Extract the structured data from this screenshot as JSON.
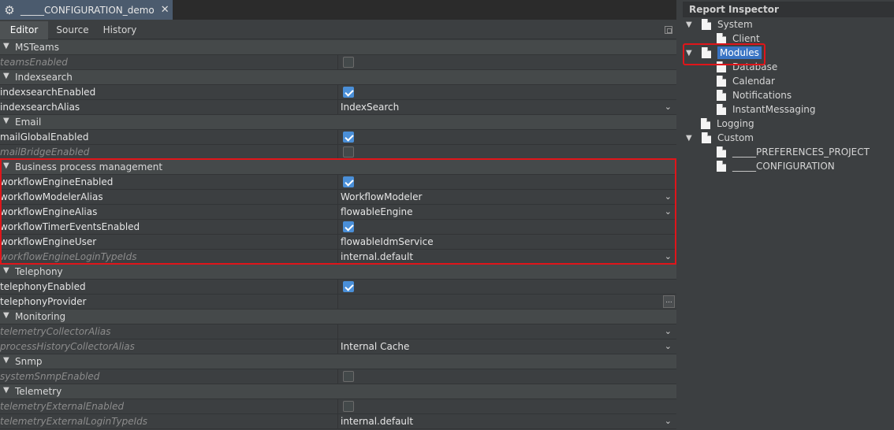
{
  "file_tab": {
    "title": "_____CONFIGURATION_demo",
    "close": "✕"
  },
  "sub_tabs": {
    "editor": "Editor",
    "source": "Source",
    "history": "History"
  },
  "sections": {
    "msteams": "MSTeams",
    "indexsearch": "Indexsearch",
    "email": "Email",
    "bpm": "Business process management",
    "telephony": "Telephony",
    "monitoring": "Monitoring",
    "snmp": "Snmp",
    "telemetry": "Telemetry"
  },
  "props": {
    "teamsEnabled": {
      "key": "teamsEnabled",
      "checked": false
    },
    "indexsearchEnabled": {
      "key": "indexsearchEnabled",
      "checked": true
    },
    "indexsearchAlias": {
      "key": "indexsearchAlias",
      "value": "IndexSearch"
    },
    "mailGlobalEnabled": {
      "key": "mailGlobalEnabled",
      "checked": true
    },
    "mailBridgeEnabled": {
      "key": "mailBridgeEnabled",
      "checked": false
    },
    "workflowEngineEnabled": {
      "key": "workflowEngineEnabled",
      "checked": true
    },
    "workflowModelerAlias": {
      "key": "workflowModelerAlias",
      "value": "WorkflowModeler"
    },
    "workflowEngineAlias": {
      "key": "workflowEngineAlias",
      "value": "flowableEngine"
    },
    "workflowTimerEventsEnabled": {
      "key": "workflowTimerEventsEnabled",
      "checked": true
    },
    "workflowEngineUser": {
      "key": "workflowEngineUser",
      "value": "flowableIdmService"
    },
    "workflowEngineLoginTypeIds": {
      "key": "workflowEngineLoginTypeIds",
      "value": "internal.default"
    },
    "telephonyEnabled": {
      "key": "telephonyEnabled",
      "checked": true
    },
    "telephonyProvider": {
      "key": "telephonyProvider",
      "button": "..."
    },
    "telemetryCollectorAlias": {
      "key": "telemetryCollectorAlias",
      "value": ""
    },
    "processHistoryCollectorAlias": {
      "key": "processHistoryCollectorAlias",
      "value": "Internal Cache"
    },
    "systemSnmpEnabled": {
      "key": "systemSnmpEnabled",
      "checked": false
    },
    "telemetryExternalEnabled": {
      "key": "telemetryExternalEnabled",
      "checked": false
    },
    "telemetryExternalLoginTypeIds": {
      "key": "telemetryExternalLoginTypeIds",
      "value": "internal.default"
    }
  },
  "inspector": {
    "title": "Report Inspector",
    "tree": {
      "system": "System",
      "client": "Client",
      "modules": "Modules",
      "database": "Database",
      "calendar": "Calendar",
      "notifications": "Notifications",
      "instant_messaging": "InstantMessaging",
      "logging": "Logging",
      "custom": "Custom",
      "preferences_project": "_____PREFERENCES_PROJECT",
      "configuration": "_____CONFIGURATION"
    }
  },
  "colors": {
    "highlight_box": "#e0151a",
    "checkbox_checked": "#4a8fd8",
    "selection": "#3a74c4"
  }
}
